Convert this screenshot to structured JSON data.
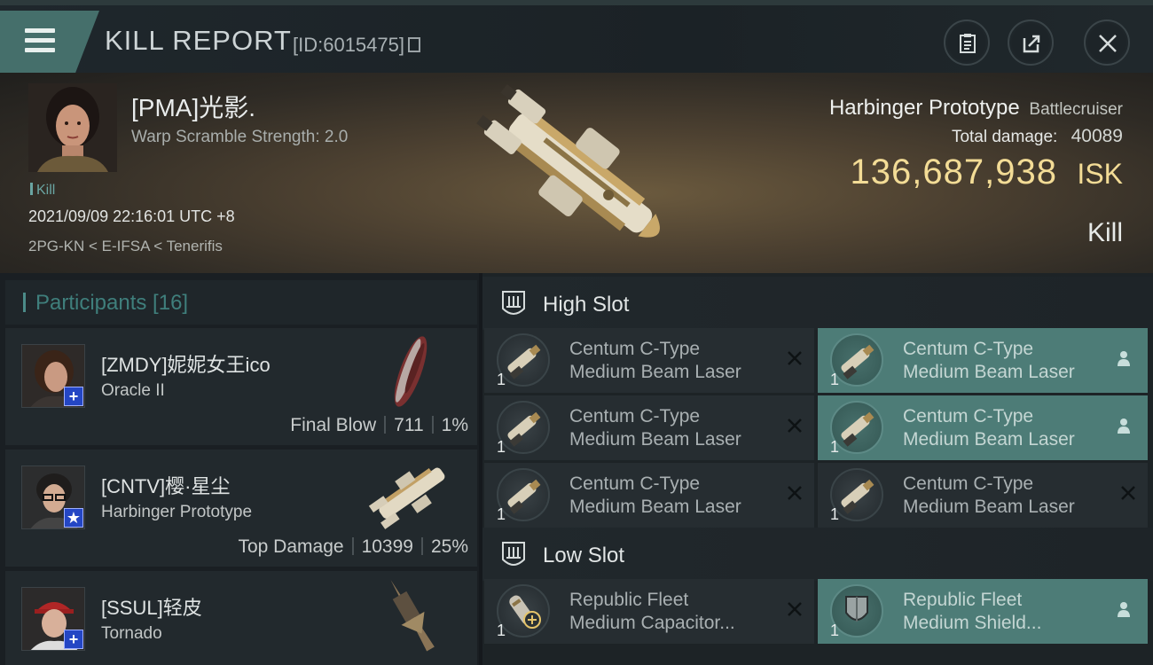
{
  "header": {
    "title": "KILL REPORT",
    "report_id": "[ID:6015475]"
  },
  "victim": {
    "name": "[PMA]光影.",
    "warp_scramble": "Warp Scramble Strength: 2.0",
    "kill_tag": "Kill",
    "datetime": "2021/09/09 22:16:01 UTC +8",
    "location": "2PG-KN < E-IFSA < Tenerifis",
    "ship_name": "Harbinger Prototype",
    "ship_class": "Battlecruiser",
    "total_damage_label": "Total damage:",
    "total_damage": "40089",
    "isk_value": "136,687,938",
    "isk_unit": "ISK",
    "result": "Kill"
  },
  "participants": {
    "title": "Participants [16]",
    "items": [
      {
        "name": "[ZMDY]妮妮女王ico",
        "ship": "Oracle II",
        "label": "Final Blow",
        "damage": "711",
        "percent": "1%",
        "badge": "+"
      },
      {
        "name": "[CNTV]樱·星尘",
        "ship": "Harbinger Prototype",
        "label": "Top Damage",
        "damage": "10399",
        "percent": "25%",
        "badge": "★"
      },
      {
        "name": "[SSUL]轻皮",
        "ship": "Tornado",
        "label": "",
        "damage": "",
        "percent": "",
        "badge": "+"
      }
    ]
  },
  "fitting": {
    "high_slot": {
      "title": "High Slot",
      "modules": [
        {
          "line1": "Centum C-Type",
          "line2": "Medium Beam Laser",
          "qty": "1"
        },
        {
          "line1": "Centum C-Type",
          "line2": "Medium Beam Laser",
          "qty": "1"
        },
        {
          "line1": "Centum C-Type",
          "line2": "Medium Beam Laser",
          "qty": "1"
        },
        {
          "line1": "Centum C-Type",
          "line2": "Medium Beam Laser",
          "qty": "1"
        },
        {
          "line1": "Centum C-Type",
          "line2": "Medium Beam Laser",
          "qty": "1"
        },
        {
          "line1": "Centum C-Type",
          "line2": "Medium Beam Laser",
          "qty": "1"
        }
      ]
    },
    "low_slot": {
      "title": "Low Slot",
      "modules": [
        {
          "line1": "Republic Fleet",
          "line2": "Medium Capacitor...",
          "qty": "1"
        },
        {
          "line1": "Republic Fleet",
          "line2": "Medium Shield...",
          "qty": "1"
        }
      ]
    }
  }
}
